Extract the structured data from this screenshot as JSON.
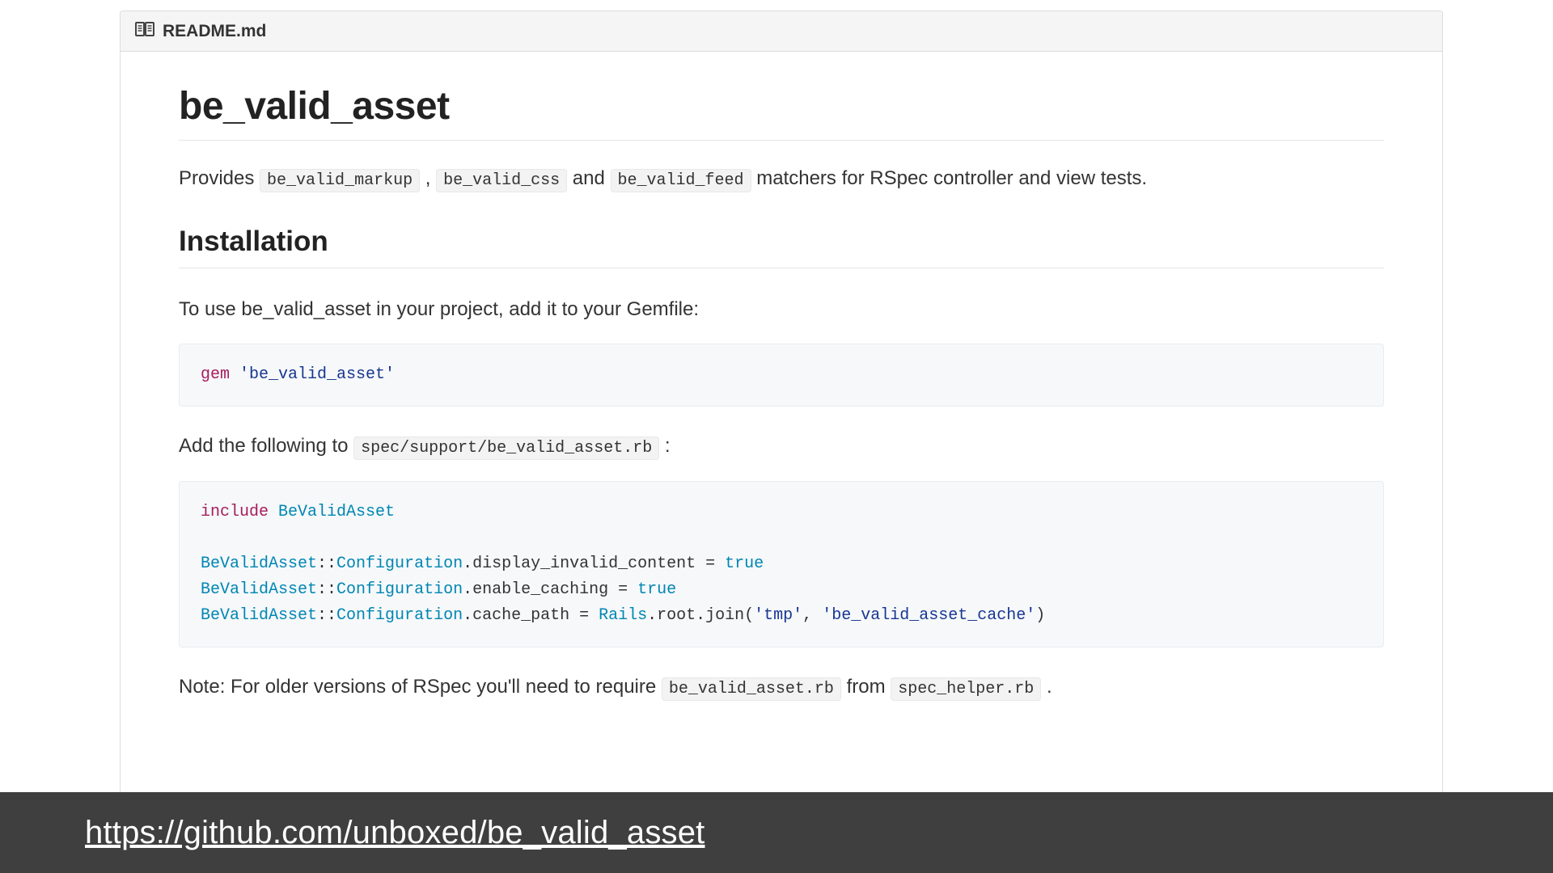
{
  "header": {
    "filename": "README.md"
  },
  "title": "be_valid_asset",
  "intro": {
    "prefix": "Provides ",
    "code1": "be_valid_markup",
    "sep1": " , ",
    "code2": "be_valid_css",
    "sep2": " and ",
    "code3": "be_valid_feed",
    "suffix": " matchers for RSpec controller and view tests."
  },
  "sections": {
    "installation": {
      "heading": "Installation",
      "gemfile_intro": "To use be_valid_asset in your project, add it to your Gemfile:",
      "gemfile_code": {
        "kw": "gem",
        "sp": " ",
        "str": "'be_valid_asset'"
      },
      "support_intro": {
        "prefix": "Add the following to ",
        "code": "spec/support/be_valid_asset.rb",
        "suffix": " :"
      },
      "support_code": {
        "l1_kw": "include",
        "l1_sp": " ",
        "l1_cls": "BeValidAsset",
        "blank": "",
        "l3_cls": "BeValidAsset",
        "l3_scope": "::",
        "l3_cfg": "Configuration",
        "l3_rest": ".display_invalid_content = ",
        "l3_true": "true",
        "l4_cls": "BeValidAsset",
        "l4_scope": "::",
        "l4_cfg": "Configuration",
        "l4_rest": ".enable_caching = ",
        "l4_true": "true",
        "l5_cls": "BeValidAsset",
        "l5_scope": "::",
        "l5_cfg": "Configuration",
        "l5_rest_a": ".cache_path = ",
        "l5_rails": "Rails",
        "l5_rest_b": ".root.join(",
        "l5_str1": "'tmp'",
        "l5_comma": ", ",
        "l5_str2": "'be_valid_asset_cache'",
        "l5_close": ")"
      },
      "note": {
        "prefix": "Note: For older versions of RSpec you'll need to require ",
        "code1": "be_valid_asset.rb",
        "mid": " from ",
        "code2": "spec_helper.rb",
        "suffix": " ."
      }
    }
  },
  "footer": {
    "url_text": "https://github.com/unboxed/be_valid_asset",
    "url_href": "https://github.com/unboxed/be_valid_asset"
  }
}
